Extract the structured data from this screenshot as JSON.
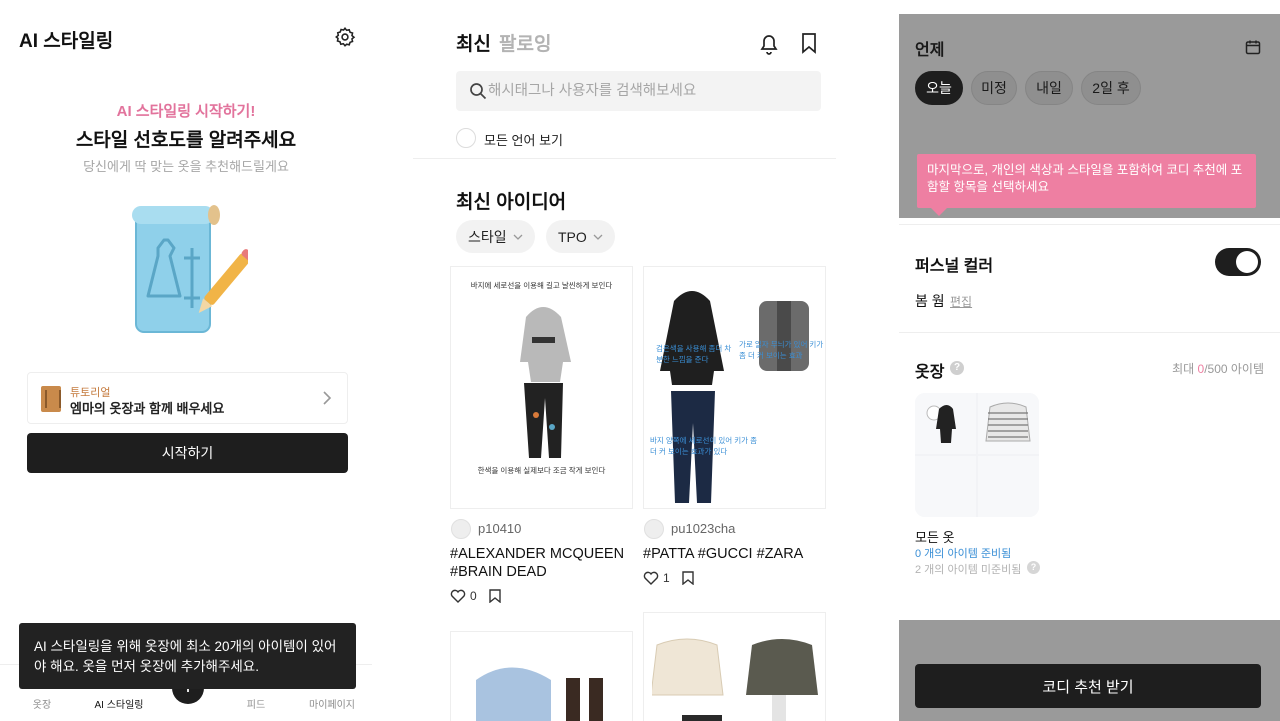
{
  "ai_styling": {
    "title": "AI 스타일링",
    "kicker": "AI 스타일링 시작하기!",
    "headline": "스타일 선호도를 알려주세요",
    "subline": "당신에게 딱 맞는 옷을 추천해드릴게요",
    "tutorial": {
      "tag": "튜토리얼",
      "title": "엠마의 옷장과 함께 배우세요"
    },
    "start_button": "시작하기",
    "toast": "AI 스타일링을 위해 옷장에 최소 20개의 아이템이 있어야 해요. 옷을 먼저 옷장에 추가해주세요.",
    "bottom_nav": [
      "옷장",
      "AI 스타일링",
      "피드",
      "마이페이지"
    ]
  },
  "feed": {
    "tabs": [
      "최신",
      "팔로잉"
    ],
    "search_placeholder": "해시태그나 사용자를 검색해보세요",
    "lang_option": "모든 언어 보기",
    "section_title": "최신 아이디어",
    "filters": [
      "스타일",
      "TPO"
    ],
    "posts": [
      {
        "caption_top": "바지에 세로선을 이용해 길고 날씬하게 보인다",
        "caption_bottom": "한색을 이용해 실제보다 조금 작게 보인다",
        "user": "p10410",
        "hashtags": [
          "#ALEXANDER MCQUEEN",
          "#BRAIN DEAD"
        ],
        "likes": "0"
      },
      {
        "caption_a": "검은색을 사용해 좀더 차분한 느낌을 준다",
        "caption_b": "가로 일자 무늬가 있어 키가 좀 더 커 보이는 효과",
        "caption_c": "바지 양쪽에 세로선이 있어 키가 좀 더 커 보이는 효과가 있다",
        "user": "pu1023cha",
        "hashtags": [
          "#PATTA #GUCCI #ZARA"
        ],
        "likes": "1"
      }
    ]
  },
  "coordination": {
    "when_title": "언제",
    "days": [
      "오늘",
      "미정",
      "내일",
      "2일 후"
    ],
    "selected_day": "오늘",
    "tooltip": "마지막으로, 개인의 색상과 스타일을 포함하여 코디 추천에 포함할 항목을 선택하세요",
    "personal_color_title": "퍼스널 컬러",
    "personal_color_on": true,
    "season": "봄 웜",
    "edit_link": "편집",
    "wardrobe_title": "옷장",
    "max_prefix": "최대 ",
    "max_count": "0",
    "max_suffix": "/500 아이템",
    "folder_name": "모든 옷",
    "ready_text": "0 개의 아이템 준비됨",
    "not_ready_text": "2 개의 아이템 미준비됨",
    "cta": "코디 추천 받기"
  },
  "colors": {
    "accent_pink": "#ee7fa2",
    "dark": "#1e1e1e",
    "link_blue": "#3a8fd6"
  }
}
